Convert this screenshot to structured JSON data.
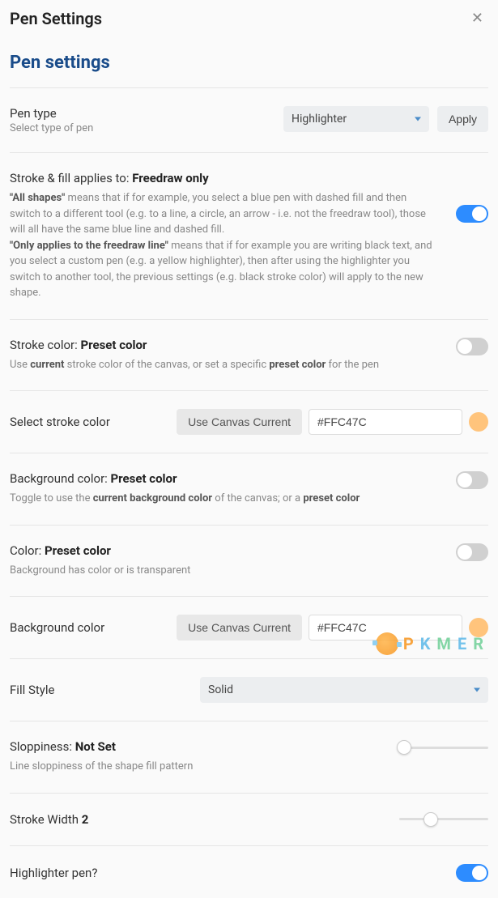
{
  "header": {
    "title": "Pen Settings"
  },
  "heading": "Pen settings",
  "penType": {
    "label": "Pen type",
    "sub": "Select type of pen",
    "value": "Highlighter",
    "apply": "Apply"
  },
  "strokeFill": {
    "label_prefix": "Stroke & fill applies to: ",
    "label_bold": "Freedraw only",
    "desc_all_bold": "\"All shapes\"",
    "desc_all": " means that if for example, you select a blue pen with dashed fill and then switch to a different tool (e.g. to a line, a circle, an arrow - i.e. not the freedraw tool), those will all have the same blue line and dashed fill.",
    "desc_only_bold": "\"Only applies to the freedraw line\"",
    "desc_only": " means that if for example you are writing black text, and you select a custom pen (e.g. a yellow highlighter), then after using the highlighter you switch to another tool, the previous settings (e.g. black stroke color) will apply to the new shape.",
    "on": true
  },
  "strokeColor": {
    "label_prefix": "Stroke color: ",
    "label_bold": "Preset color",
    "desc_p1": "Use ",
    "desc_b1": "current",
    "desc_p2": " stroke color of the canvas, or set a specific ",
    "desc_b2": "preset color",
    "desc_p3": " for the pen",
    "on": false
  },
  "selectStroke": {
    "label": "Select stroke color",
    "btn": "Use Canvas Current",
    "value": "#FFC47C",
    "swatch": "#FFC47C"
  },
  "bgColor": {
    "label_prefix": "Background color: ",
    "label_bold": "Preset color",
    "desc_p1": "Toggle to use the ",
    "desc_b1": "current background color",
    "desc_p2": " of the canvas; or a ",
    "desc_b2": "preset color",
    "on": false
  },
  "color": {
    "label_prefix": "Color: ",
    "label_bold": "Preset color",
    "desc": "Background has color or is transparent",
    "on": false
  },
  "bgColorSelect": {
    "label": "Background color",
    "btn": "Use Canvas Current",
    "value": "#FFC47C",
    "swatch": "#FFC47C"
  },
  "fillStyle": {
    "label": "Fill Style",
    "value": "Solid"
  },
  "sloppiness": {
    "label_prefix": "Sloppiness: ",
    "label_bold": "Not Set",
    "desc": "Line sloppiness of the shape fill pattern",
    "pct": 5
  },
  "strokeWidth": {
    "label_prefix": "Stroke Width ",
    "label_bold": "2",
    "pct": 35
  },
  "highlighterPen": {
    "label": "Highlighter pen?",
    "on": true
  },
  "watermark": {
    "p": "P",
    "k": "K",
    "m": "M",
    "e": "E",
    "r": "R"
  }
}
